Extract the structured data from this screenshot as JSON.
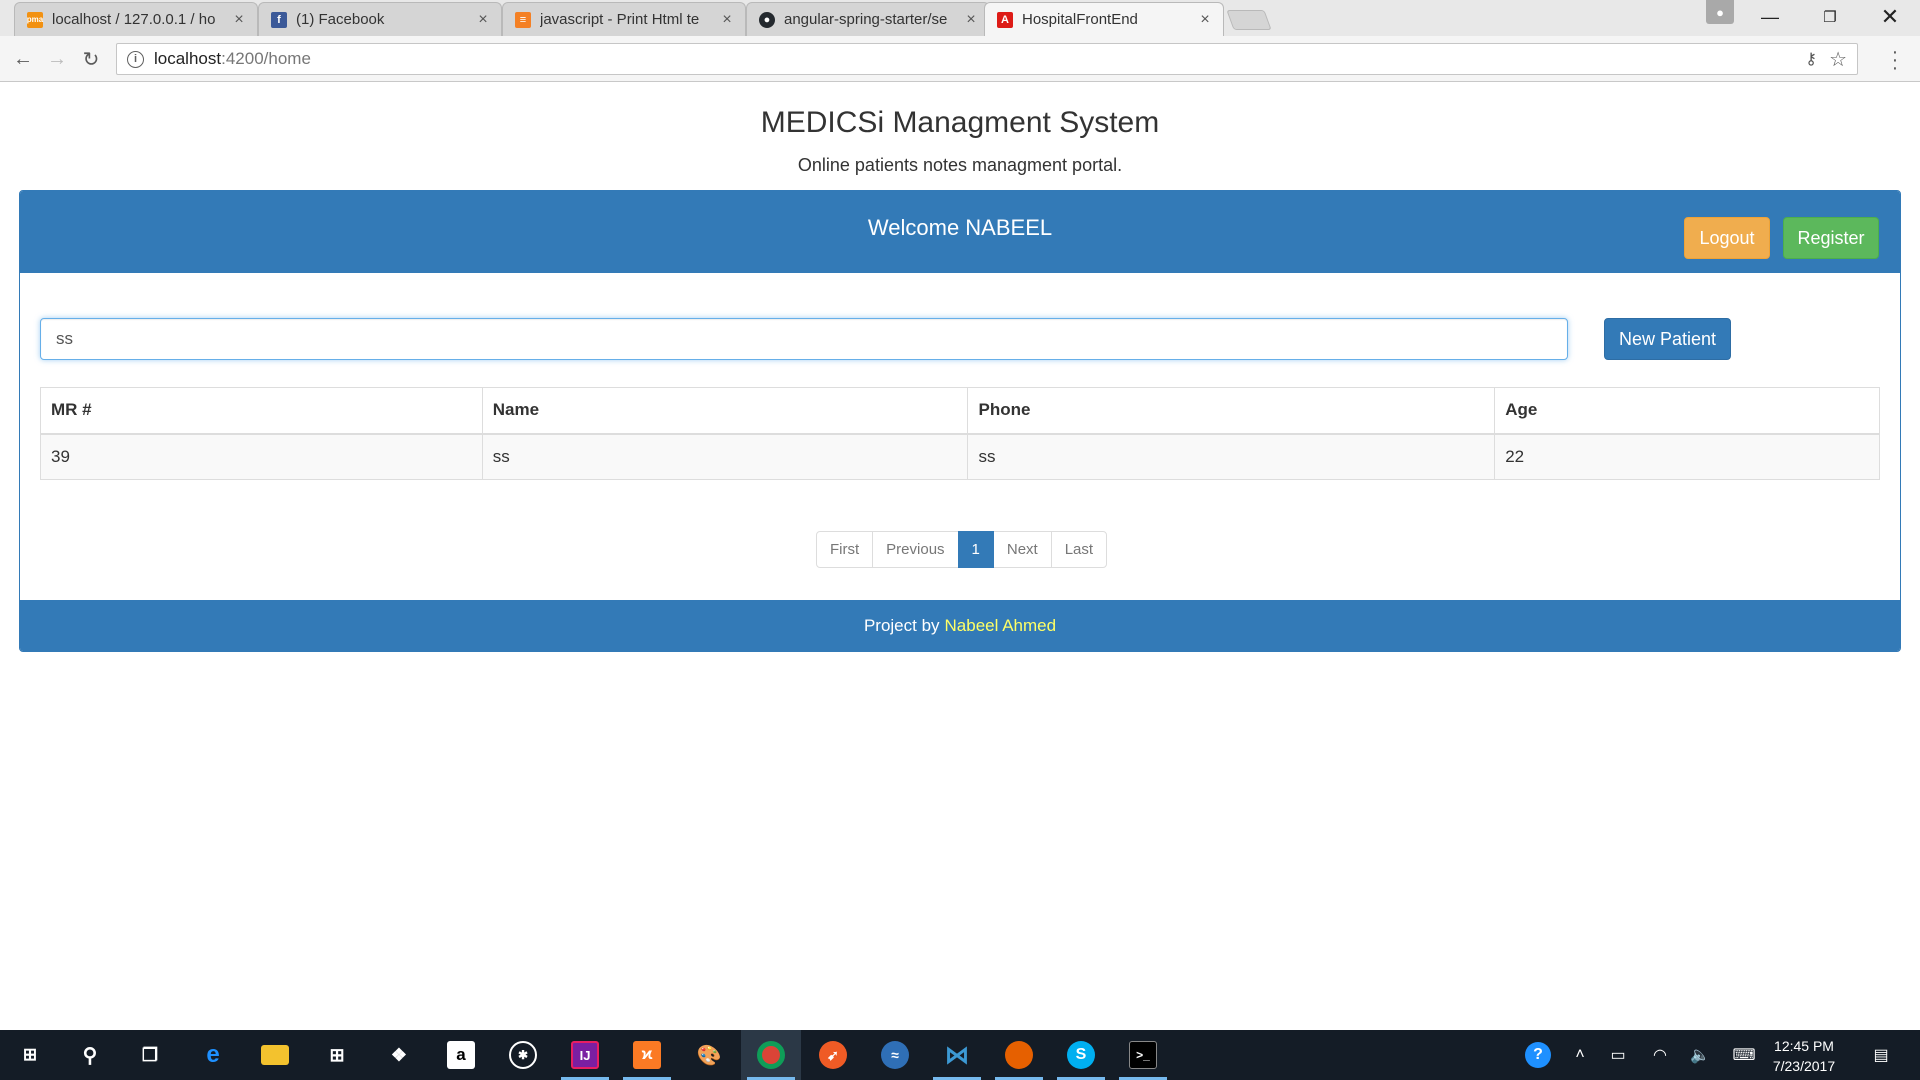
{
  "browser": {
    "tabs": [
      {
        "title": "localhost / 127.0.0.1 / ho",
        "icon": "phpmyadmin-icon"
      },
      {
        "title": "(1) Facebook",
        "icon": "facebook-icon"
      },
      {
        "title": "javascript - Print Html te",
        "icon": "stackoverflow-icon"
      },
      {
        "title": "angular-spring-starter/se",
        "icon": "github-icon"
      },
      {
        "title": "HospitalFrontEnd",
        "icon": "angular-icon",
        "active": true
      }
    ],
    "address": {
      "host": "localhost",
      "path": ":4200/home"
    }
  },
  "page": {
    "title": "MEDICSi Managment System",
    "subtitle": "Online patients notes managment portal.",
    "welcome": "Welcome NABEEL",
    "logout_label": "Logout",
    "register_label": "Register",
    "search_value": "ss",
    "new_patient_label": "New Patient",
    "table": {
      "headers": [
        "MR #",
        "Name",
        "Phone",
        "Age"
      ],
      "rows": [
        [
          "39",
          "ss",
          "ss",
          "22"
        ]
      ]
    },
    "pagination": {
      "first": "First",
      "previous": "Previous",
      "current": "1",
      "next": "Next",
      "last": "Last"
    },
    "footer": {
      "prefix": "Project by",
      "author": "Nabeel Ahmed"
    }
  },
  "colors": {
    "primary": "#337ab7",
    "warning": "#f0ad4e",
    "success": "#5cb85c",
    "footer_author": "#ffff66"
  },
  "taskbar": {
    "apps": [
      "start-icon",
      "search-icon",
      "task-view-icon",
      "edge-icon",
      "file-explorer-icon",
      "store-icon",
      "dropbox-icon",
      "amazon-icon",
      "app-icon",
      "intellij-icon",
      "xampp-icon",
      "paint-icon",
      "chrome-icon",
      "postman-icon",
      "app-icon",
      "vscode-icon",
      "firefox-icon",
      "skype-icon",
      "terminal-icon"
    ],
    "time": "12:45 PM",
    "date": "7/23/2017"
  }
}
